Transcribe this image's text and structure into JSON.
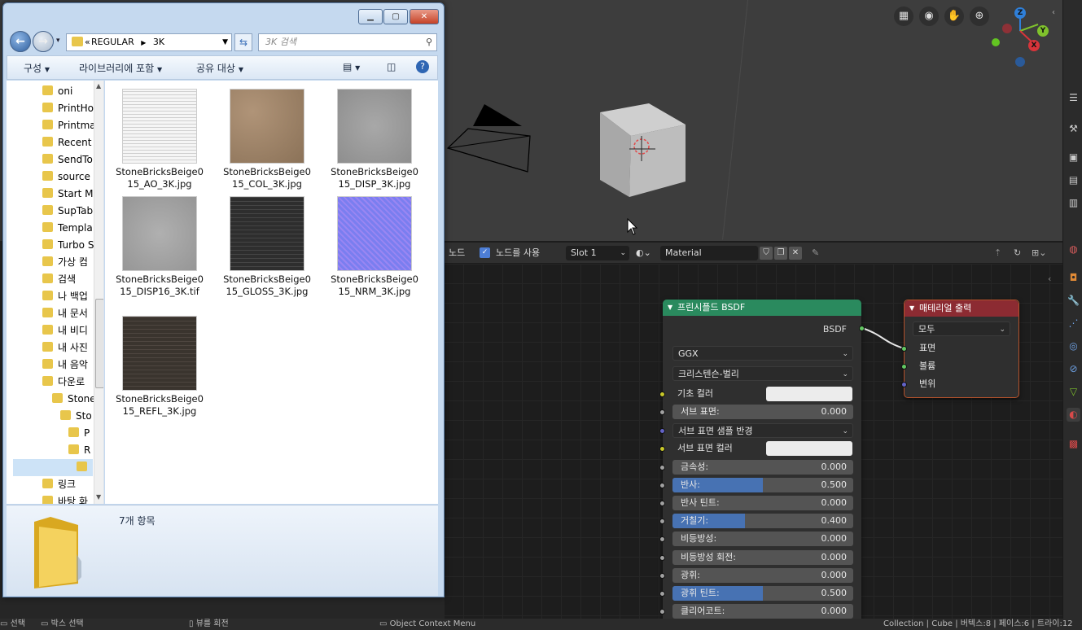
{
  "blender": {
    "viewport": {
      "tool_icons": [
        "grid-icon",
        "camera-icon",
        "hand-icon",
        "zoom-icon"
      ],
      "gizmo": {
        "z": "Z",
        "y": "Y",
        "x": "X"
      }
    },
    "node_header": {
      "editor_label": "노드",
      "use_nodes_label": "노드를 사용",
      "slot": "Slot 1",
      "material": "Material"
    },
    "bsdf_node": {
      "title": "프린시플드 BSDF",
      "output_label": "BSDF",
      "distribution": "GGX",
      "subsurface_method": "크리스텐슨-벌리",
      "base_color_label": "기초 컬러",
      "subsurface_label": "서브 표면:",
      "subsurface_value": "0.000",
      "subsurface_radius_label": "서브 표면 샘플 반경",
      "subsurface_color_label": "서브 표면 컬러",
      "sliders": [
        {
          "label": "금속성:",
          "value": "0.000",
          "fill": 0
        },
        {
          "label": "반사:",
          "value": "0.500",
          "fill": 0.5
        },
        {
          "label": "반사 틴트:",
          "value": "0.000",
          "fill": 0
        },
        {
          "label": "거칠기:",
          "value": "0.400",
          "fill": 0.4
        },
        {
          "label": "비등방성:",
          "value": "0.000",
          "fill": 0
        },
        {
          "label": "비등방성 회전:",
          "value": "0.000",
          "fill": 0
        },
        {
          "label": "광휘:",
          "value": "0.000",
          "fill": 0
        },
        {
          "label": "광휘 틴트:",
          "value": "0.500",
          "fill": 0.5
        },
        {
          "label": "클리어코트:",
          "value": "0.000",
          "fill": 0
        }
      ]
    },
    "output_node": {
      "title": "매테리얼 출력",
      "target": "모두",
      "inputs": [
        "표면",
        "볼륨",
        "변위"
      ]
    },
    "status_bar": {
      "select": "선택",
      "box_select": "박스 선택",
      "rotate_view": "뷰를 회전",
      "context_menu": "Object Context Menu",
      "stats": "Collection | Cube | 버텍스:8 | 페이스:6 | 트라이:12"
    },
    "colors": {
      "bsdf_header": "#2a8a5e",
      "output_header": "#8c2b32",
      "slider_fill": "#4772b3"
    }
  },
  "explorer": {
    "address": {
      "part1": "REGULAR",
      "part2": "3K"
    },
    "search_placeholder": "3K 검색",
    "toolbar": {
      "organize": "구성",
      "include_library": "라이브러리에 포함",
      "share": "공유 대상"
    },
    "nav_items": [
      "oni",
      "PrintHo",
      "Printma",
      "Recent",
      "SendTo",
      "source",
      "Start M",
      "SupTab",
      "Templa",
      "Turbo S",
      "가상 컴",
      "검색",
      "나 백업",
      "내 문서",
      "내 비디",
      "내 사진",
      "내 음악",
      "다운로",
      "Stone",
      "Sto",
      "P",
      "R",
      "",
      "링크",
      "바탕 화"
    ],
    "files": [
      {
        "name": "StoneBricksBeige015_AO_3K.jpg",
        "tex": "ao"
      },
      {
        "name": "StoneBricksBeige015_COL_3K.jpg",
        "tex": "col"
      },
      {
        "name": "StoneBricksBeige015_DISP_3K.jpg",
        "tex": "disp"
      },
      {
        "name": "StoneBricksBeige015_DISP16_3K.tif",
        "tex": "disp16"
      },
      {
        "name": "StoneBricksBeige015_GLOSS_3K.jpg",
        "tex": "gloss"
      },
      {
        "name": "StoneBricksBeige015_NRM_3K.jpg",
        "tex": "nrm"
      },
      {
        "name": "StoneBricksBeige015_REFL_3K.jpg",
        "tex": "refl"
      }
    ],
    "item_count": "7개 항목"
  }
}
